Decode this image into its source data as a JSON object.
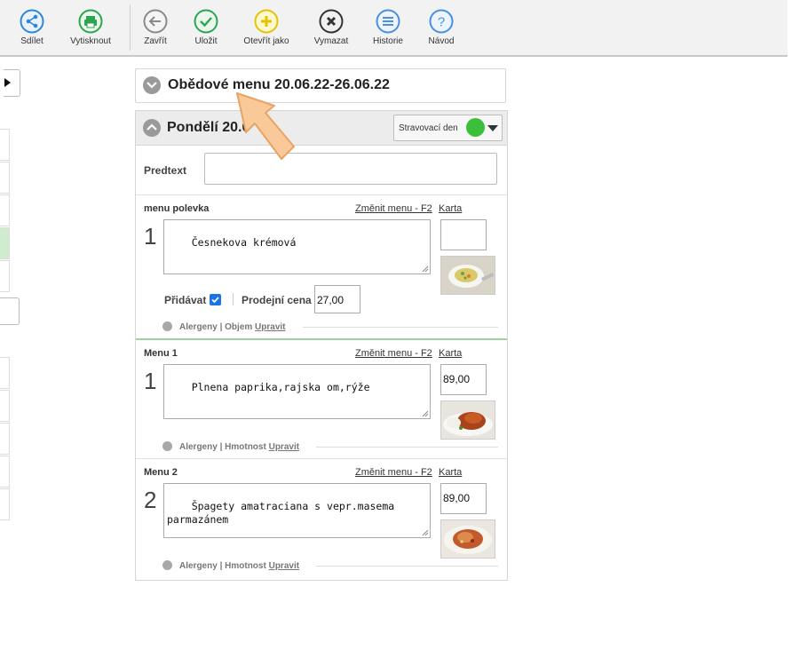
{
  "toolbar": {
    "share": "Sdílet",
    "print": "Vytisknout",
    "close": "Zavřít",
    "save": "Uložit",
    "open_as": "Otevřít jako",
    "delete": "Vymazat",
    "history": "Historie",
    "help": "Návod"
  },
  "colors": {
    "share": "#2f86d9",
    "print": "#2da44e",
    "close": "#8a8a8a",
    "save": "#2da44e",
    "open_as": "#e6c300",
    "delete": "#333333",
    "history": "#4a8fe0",
    "help": "#4a8fe0",
    "day_status": "#3cc03c"
  },
  "header": {
    "title": "Obědové menu 20.06.22-26.06.22"
  },
  "day": {
    "title": "Pondělí 20.0",
    "select_label": "Stravovací den",
    "predtext_label": "Predtext",
    "predtext_value": ""
  },
  "items": [
    {
      "name": "menu polevka",
      "change_link": "Změnit menu - F2",
      "card_link": "Karta",
      "number": "1",
      "text": "Česnekova krémová",
      "price": "",
      "add_label": "Přidávat",
      "sell_price_label": "Prodejní cena",
      "sell_price": "27,00",
      "alerg_prefix": "Alergeny | Objem ",
      "alerg_edit": "Upravit"
    },
    {
      "name": "Menu 1",
      "change_link": "Změnit menu - F2",
      "card_link": "Karta",
      "number": "1",
      "text": "Plnena paprika,rajska om,rýže",
      "price": "89,00",
      "alerg_prefix": "Alergeny | Hmotnost ",
      "alerg_edit": "Upravit"
    },
    {
      "name": "Menu 2",
      "change_link": "Změnit menu - F2",
      "card_link": "Karta",
      "number": "2",
      "text": "Špagety amatraciana s vepr.masema\nparmazánem",
      "price": "89,00",
      "alerg_prefix": "Alergeny | Hmotnost ",
      "alerg_edit": "Upravit"
    }
  ]
}
